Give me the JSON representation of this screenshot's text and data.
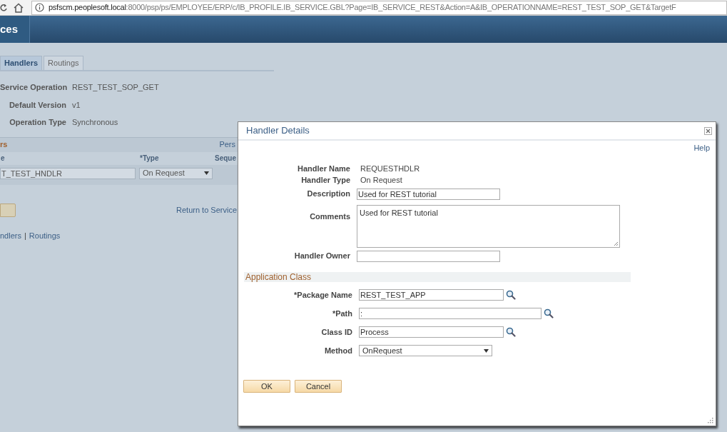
{
  "address_bar": {
    "host": "psfscm.peoplesoft.local",
    "rest": ":8000/psp/ps/EMPLOYEE/ERP/c/IB_PROFILE.IB_SERVICE.GBL?Page=IB_SERVICE_REST&Action=A&IB_OPERATIONNAME=REST_TEST_SOP_GET&TargetF"
  },
  "header": {
    "title": "ces"
  },
  "tabs": [
    {
      "label": "Handlers",
      "selected": true
    },
    {
      "label": "Routings",
      "selected": false
    }
  ],
  "fields": [
    {
      "label": "Service Operation",
      "value": "REST_TEST_SOP_GET"
    },
    {
      "label": "Default Version",
      "value": "v1"
    },
    {
      "label": "Operation Type",
      "value": "Synchronous"
    }
  ],
  "grid": {
    "title": "rs",
    "personalize": "Pers",
    "columns": [
      "e",
      "*Type",
      "Seque"
    ],
    "rows": [
      {
        "name": "T_TEST_HNDLR",
        "type": "On Request"
      }
    ]
  },
  "return_link": "Return to Service",
  "bottom_links": [
    "ndlers",
    "Routings"
  ],
  "link_separator": "|",
  "dialog": {
    "title": "Handler Details",
    "help": "Help",
    "info": [
      {
        "label": "Handler Name",
        "value": "REQUESTHDLR"
      },
      {
        "label": "Handler Type",
        "value": "On Request"
      }
    ],
    "description": {
      "label": "Description",
      "value": "Used for REST tutorial"
    },
    "comments": {
      "label": "Comments",
      "value": "Used for REST tutorial"
    },
    "owner": {
      "label": "Handler Owner"
    },
    "section": "Application Class",
    "class_fields": [
      {
        "label": "*Package Name",
        "value": "REST_TEST_APP",
        "kind": "lookup"
      },
      {
        "label": "*Path",
        "value": ":",
        "kind": "lookup"
      },
      {
        "label": "Class ID",
        "value": "Process",
        "kind": "lookup"
      },
      {
        "label": "Method",
        "value": "OnRequest",
        "kind": "select"
      }
    ],
    "buttons": [
      "OK",
      "Cancel"
    ]
  }
}
